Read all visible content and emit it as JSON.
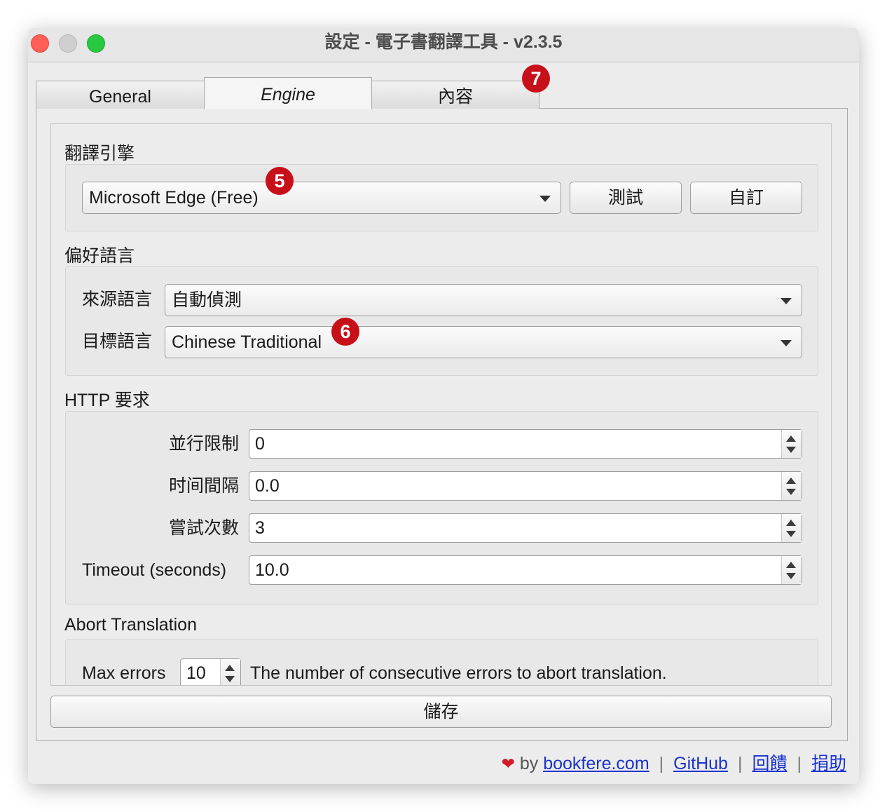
{
  "window": {
    "title": "設定 - 電子書翻譯工具 - v2.3.5"
  },
  "tabs": [
    {
      "label": "General"
    },
    {
      "label": "Engine"
    },
    {
      "label": "內容"
    }
  ],
  "engine": {
    "section_title": "翻譯引擎",
    "selected_engine": "Microsoft Edge (Free)",
    "test_button": "測試",
    "custom_button": "自訂"
  },
  "language": {
    "section_title": "偏好語言",
    "source_label": "來源語言",
    "source_value": "自動偵測",
    "target_label": "目標語言",
    "target_value": "Chinese Traditional"
  },
  "http": {
    "section_title": "HTTP 要求",
    "concurrency_label": "並行限制",
    "concurrency_value": "0",
    "interval_label": "时间間隔",
    "interval_value": "0.0",
    "attempts_label": "嘗試次數",
    "attempts_value": "3",
    "timeout_label": "Timeout (seconds)",
    "timeout_value": "10.0"
  },
  "abort": {
    "section_title": "Abort Translation",
    "max_errors_label": "Max errors",
    "max_errors_value": "10",
    "description": "The number of consecutive errors to abort translation."
  },
  "save_button": "儲存",
  "footer": {
    "by": "by",
    "site": "bookfere.com",
    "github": "GitHub",
    "feedback": "回饋",
    "donate": "捐助"
  },
  "badges": [
    "5",
    "6",
    "7"
  ],
  "colors": {
    "badge": "#c8101a",
    "link": "#1a33cc",
    "heart": "#d41a2a"
  }
}
